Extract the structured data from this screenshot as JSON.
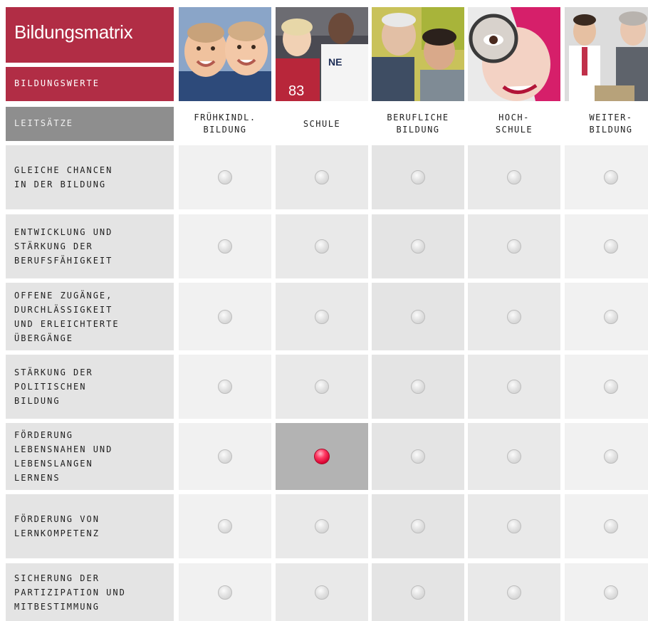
{
  "header": {
    "title": "Bildungsmatrix",
    "subtitle": "BILDUNGSWERTE",
    "row_header": "LEITSÄTZE"
  },
  "columns": [
    {
      "label": "FRÜHKINDL.\nBILDUNG",
      "photo": "toddlers-photo"
    },
    {
      "label": "SCHULE",
      "photo": "schoolchildren-photo"
    },
    {
      "label": "BERUFLICHE\nBILDUNG",
      "photo": "trainee-photo"
    },
    {
      "label": "HOCH-\nSCHULE",
      "photo": "student-magnifier-photo"
    },
    {
      "label": "WEITER-\nBILDUNG",
      "photo": "adult-learners-photo"
    }
  ],
  "rows": [
    {
      "label": "GLEICHE CHANCEN\nIN DER BILDUNG"
    },
    {
      "label": "ENTWICKLUNG UND\nSTÄRKUNG DER\nBERUFSFÄHIGKEIT"
    },
    {
      "label": "OFFENE ZUGÄNGE,\nDURCHLÄSSIGKEIT\nUND ERLEICHTERTE\nÜBERGÄNGE"
    },
    {
      "label": "STÄRKUNG DER\nPOLITISCHEN\nBILDUNG"
    },
    {
      "label": "FÖRDERUNG\nLEBENSNAHEN UND\nLEBENSLANGEN\nLERNENS"
    },
    {
      "label": "FÖRDERUNG VON\nLERNKOMPETENZ"
    },
    {
      "label": "SICHERUNG DER\nPARTIZIPATION UND\nMITBESTIMMUNG"
    }
  ],
  "selected": {
    "row": 4,
    "column": 1
  },
  "colors": {
    "brand": "#b12d45",
    "header_gray": "#8e8e8e",
    "active_radio": "#e8003a"
  }
}
